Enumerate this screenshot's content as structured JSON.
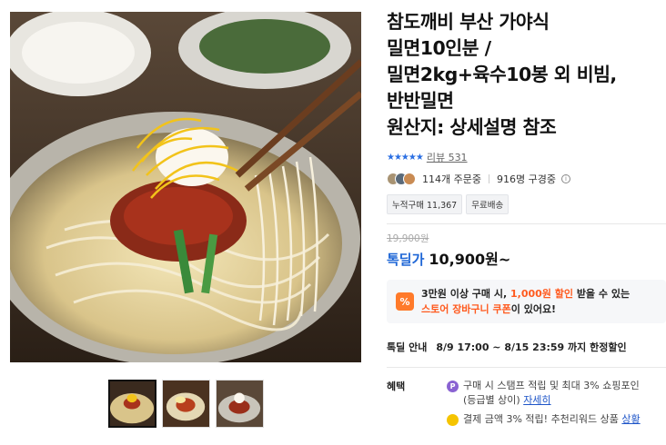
{
  "product": {
    "title": "참도깨비 부산 가야식\n밀면10인분 /\n밀면2kg+육수10봉 외 비빔,\n반반밀면\n원산지: 상세설명 참조",
    "rating": {
      "stars": "★★★★★",
      "review_label": "리뷰 531"
    },
    "buyers": {
      "orders": "114개 주문중",
      "subscribers": "916명 구경중",
      "info_glyph": "i"
    },
    "tags": [
      "누적구매 11,367",
      "무료배송"
    ],
    "original_price": "19,900원",
    "deal_label": "톡딜가",
    "price": "10,900원~",
    "coupon": {
      "icon_glyph": "%",
      "line1_a": "3만원 이상 구매 시, ",
      "line1_hl": "1,000원 할인",
      "line1_b": " 받을 수 있는",
      "line2_hl": "스토어 장바구니 쿠폰",
      "line2_b": "이 있어요!"
    },
    "deal_info": {
      "label": "톡딜 안내",
      "period": "8/9 17:00 ~ 8/15 23:59 까지 한정할인"
    },
    "benefit": {
      "label": "혜택",
      "p_glyph": "P",
      "line1": "구매 시 스탬프 적립 및 최대 3% 쇼핑포인",
      "line2_a": "(등급별 상이) ",
      "line2_link": "자세히",
      "line3_a": "결제 금액 3% 적립! 추천리워드 상품 ",
      "line3_link": "상황"
    }
  },
  "colors": {
    "accent_blue": "#1e66d6",
    "coupon_orange": "#ff5a1e",
    "star_blue": "#2b6fe3"
  },
  "icons": {
    "main_image": "naengmyeon-photo",
    "thumb1": "thumbnail-1",
    "thumb2": "thumbnail-2",
    "thumb3": "thumbnail-3"
  }
}
